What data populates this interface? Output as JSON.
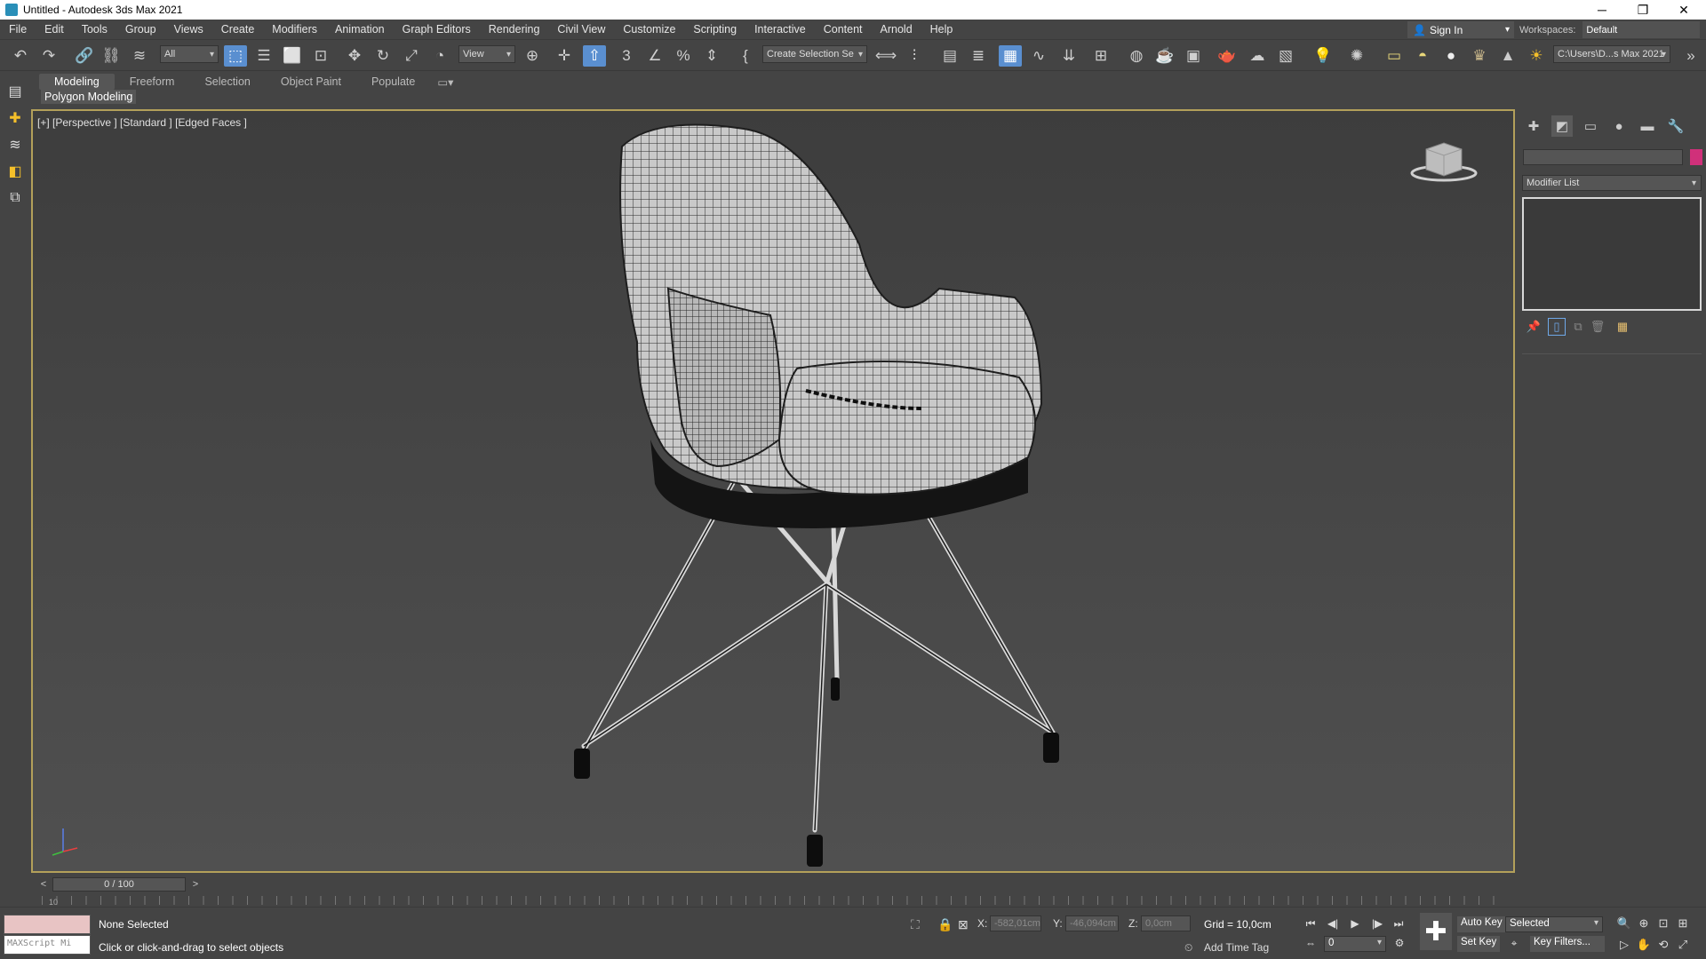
{
  "window": {
    "title": "Untitled - Autodesk 3ds Max 2021",
    "minimize": "─",
    "restore": "❐",
    "close": "✕"
  },
  "menu": [
    "File",
    "Edit",
    "Tools",
    "Group",
    "Views",
    "Create",
    "Modifiers",
    "Animation",
    "Graph Editors",
    "Rendering",
    "Civil View",
    "Customize",
    "Scripting",
    "Interactive",
    "Content",
    "Arnold",
    "Help"
  ],
  "account": {
    "sign_in": "Sign In",
    "workspaces_label": "Workspaces:",
    "workspace_value": "Default"
  },
  "toolbar": {
    "selection_filter": "All",
    "ref_coord": "View",
    "named_selection": "Create Selection Se",
    "project_path": "C:\\Users\\D...s Max 2021"
  },
  "ribbon": {
    "tabs": [
      "Modeling",
      "Freeform",
      "Selection",
      "Object Paint",
      "Populate"
    ],
    "active_tab": "Modeling",
    "panel": "Polygon Modeling"
  },
  "viewport": {
    "label": "[+] [Perspective ] [Standard ] [Edged Faces ]"
  },
  "timeline": {
    "frame": "0 / 100",
    "prev": "<",
    "next": ">",
    "ruler_start": "10"
  },
  "command_panel": {
    "modifier_list": "Modifier List",
    "color": "#d0307a"
  },
  "status": {
    "selection": "None Selected",
    "prompt": "Click or click-and-drag to select objects",
    "maxscript": "MAXScript Mi",
    "x_label": "X:",
    "x_value": "-582,01cm",
    "y_label": "Y:",
    "y_value": "-46,094cm",
    "z_label": "Z:",
    "z_value": "0,0cm",
    "grid": "Grid = 10,0cm",
    "add_time_tag": "Add Time Tag",
    "current_frame": "0"
  },
  "keys": {
    "auto_key": "Auto Key",
    "set_key": "Set Key",
    "key_mode": "Selected",
    "key_filters": "Key Filters..."
  },
  "colors": {
    "accent": "#5a8fd0",
    "viewport_border": "#b3a05a",
    "background": "#444444"
  }
}
